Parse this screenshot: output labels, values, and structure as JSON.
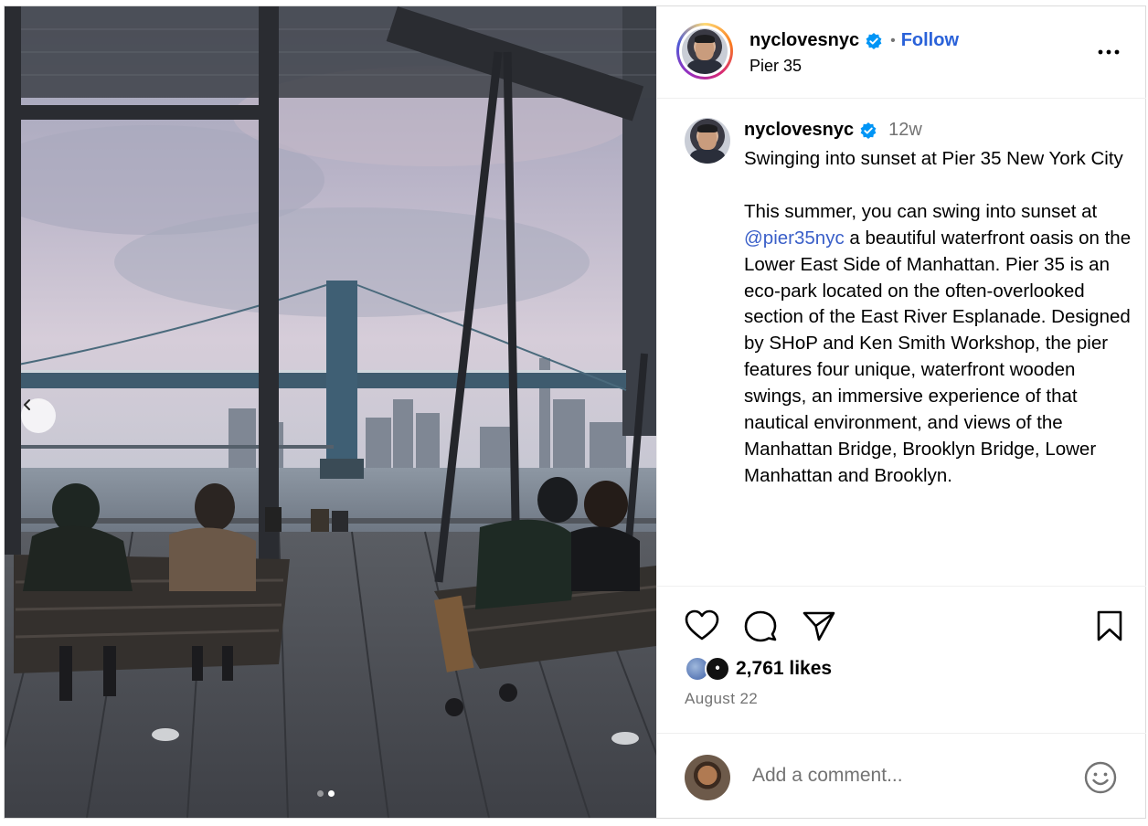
{
  "post": {
    "username": "nyclovesnyc",
    "follow_label": "Follow",
    "separator": "•",
    "location": "Pier 35",
    "more_icon": "more-horizontal-icon"
  },
  "caption": {
    "username": "nyclovesnyc",
    "time": "12w",
    "text_part1": "Swinging into sunset at Pier 35 New York City\n\nThis summer, you can swing into sunset at ",
    "mention": "@pier35nyc",
    "text_part2": " a beautiful waterfront oasis on the Lower East Side of Manhattan. Pier 35 is an eco-park located on the often-overlooked section of the East River Esplanade. Designed by SHoP and Ken Smith Workshop, the pier features four unique, waterfront wooden swings, an immersive experience of that nautical environment, and views of the Manhattan Bridge, Brooklyn Bridge, Lower Manhattan and Brooklyn."
  },
  "actions": {
    "like_icon": "heart-icon",
    "comment_icon": "comment-icon",
    "share_icon": "share-icon",
    "save_icon": "bookmark-icon"
  },
  "likes": "2,761 likes",
  "date": "August 22",
  "comment": {
    "placeholder": "Add a comment..."
  },
  "carousel": {
    "total": 2,
    "active_index": 1
  },
  "colors": {
    "follow": "#2a62d9",
    "mention": "#3a5fc8",
    "verified": "#0095f6",
    "muted": "#737373"
  }
}
